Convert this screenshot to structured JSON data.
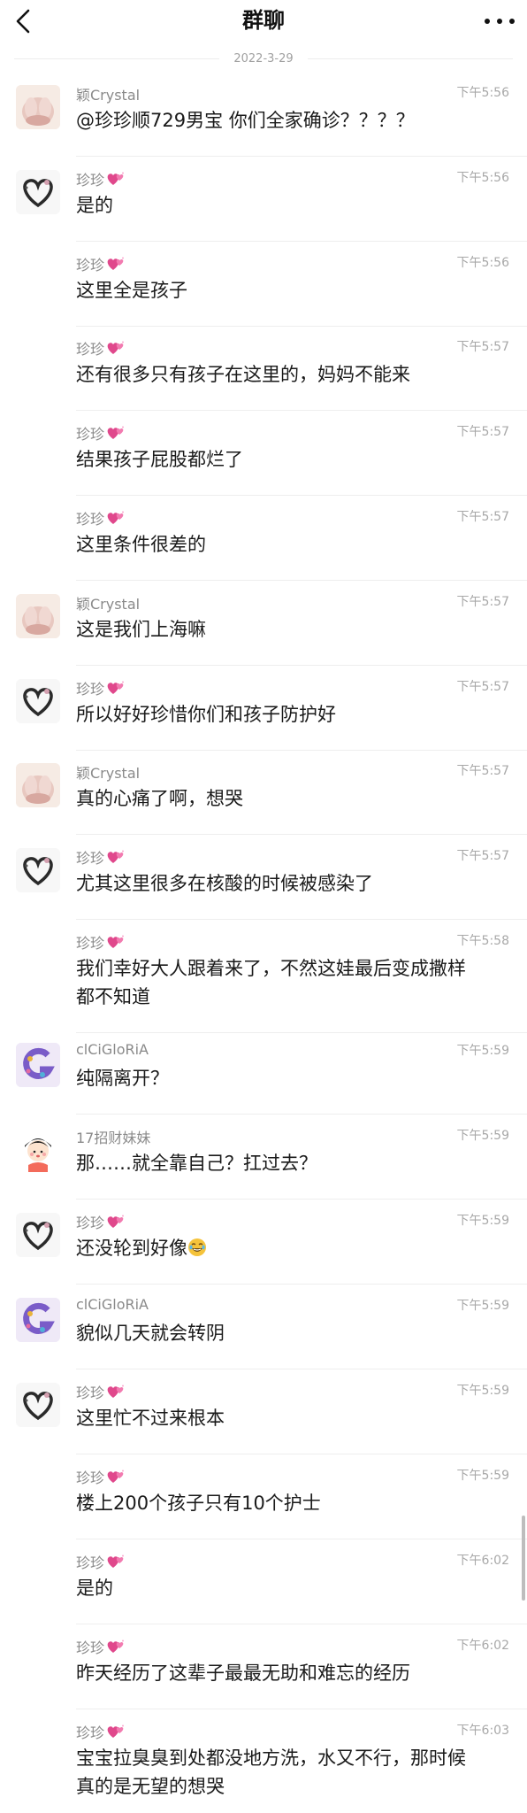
{
  "header": {
    "title": "群聊"
  },
  "date_divider": "2022-3-29",
  "messages": [
    {
      "sender": "颖Crystal",
      "avatar": "crystal",
      "time": "下午5:56",
      "text": "@珍珍顺729男宝 你们全家确诊？？？？"
    },
    {
      "sender": "珍珍",
      "avatar": "heart",
      "time": "下午5:56",
      "text": "是的"
    },
    {
      "sender": "珍珍",
      "avatar": "none",
      "time": "下午5:56",
      "text": "这里全是孩子"
    },
    {
      "sender": "珍珍",
      "avatar": "none",
      "time": "下午5:57",
      "text": "还有很多只有孩子在这里的，妈妈不能来"
    },
    {
      "sender": "珍珍",
      "avatar": "none",
      "time": "下午5:57",
      "text": "结果孩子屁股都烂了"
    },
    {
      "sender": "珍珍",
      "avatar": "none",
      "time": "下午5:57",
      "text": "这里条件很差的"
    },
    {
      "sender": "颖Crystal",
      "avatar": "crystal",
      "time": "下午5:57",
      "text": "这是我们上海嘛"
    },
    {
      "sender": "珍珍",
      "avatar": "heart",
      "time": "下午5:57",
      "text": "所以好好珍惜你们和孩子防护好"
    },
    {
      "sender": "颖Crystal",
      "avatar": "crystal",
      "time": "下午5:57",
      "text": "真的心痛了啊，想哭"
    },
    {
      "sender": "珍珍",
      "avatar": "heart",
      "time": "下午5:57",
      "text": "尤其这里很多在核酸的时候被感染了"
    },
    {
      "sender": "珍珍",
      "avatar": "none",
      "time": "下午5:58",
      "text": "我们幸好大人跟着来了，不然这娃最后变成撒样",
      "text2": "都不知道"
    },
    {
      "sender": "clCiGloRiA",
      "avatar": "gloria",
      "time": "下午5:59",
      "text": "纯隔离开？"
    },
    {
      "sender": "17招财妹妹",
      "avatar": "girl",
      "time": "下午5:59",
      "text": "那……就全靠自己？扛过去？"
    },
    {
      "sender": "珍珍",
      "avatar": "heart",
      "time": "下午5:59",
      "text": "还没轮到好像",
      "emoji": "laugh"
    },
    {
      "sender": "clCiGloRiA",
      "avatar": "gloria",
      "time": "下午5:59",
      "text": "貌似几天就会转阴"
    },
    {
      "sender": "珍珍",
      "avatar": "heart",
      "time": "下午5:59",
      "text": "这里忙不过来根本"
    },
    {
      "sender": "珍珍",
      "avatar": "none",
      "time": "下午5:59",
      "text": "楼上200个孩子只有10个护士"
    },
    {
      "sender": "珍珍",
      "avatar": "none",
      "time": "下午6:02",
      "text": "是的"
    },
    {
      "sender": "珍珍",
      "avatar": "none",
      "time": "下午6:02",
      "text": "昨天经历了这辈子最最无助和难忘的经历"
    },
    {
      "sender": "珍珍",
      "avatar": "none",
      "time": "下午6:03",
      "text": "宝宝拉臭臭到处都没地方洗，水又不行，那时候",
      "text2": "真的是无望的想哭"
    }
  ],
  "colors": {
    "text": "#1a1a1a",
    "meta": "#8a8a8a",
    "heart": "#e0488c"
  }
}
